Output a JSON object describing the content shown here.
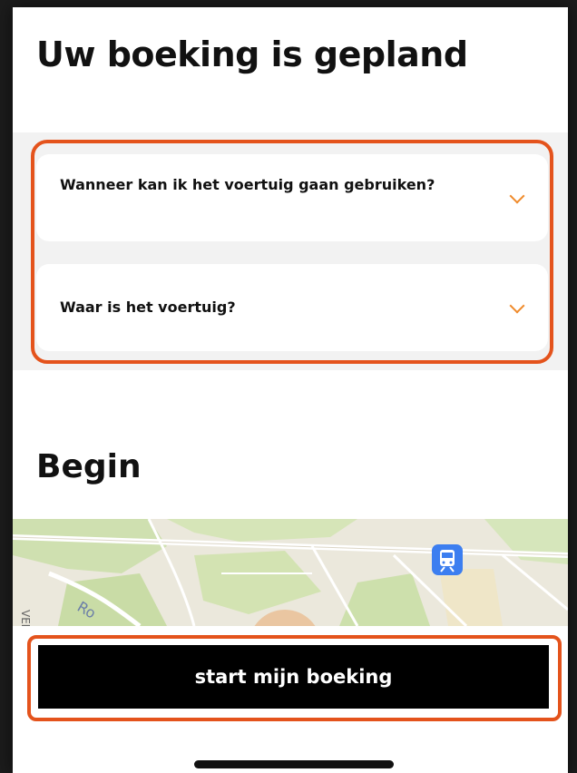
{
  "header": {
    "title": "Uw boeking is gepland"
  },
  "faq": {
    "items": [
      {
        "question": "Wanneer kan ik het voertuig gaan gebruiken?",
        "icon": "chevron-down-icon"
      },
      {
        "question": "Waar is het voertuig?",
        "icon": "chevron-down-icon"
      }
    ]
  },
  "start_section": {
    "title": "Begin"
  },
  "map": {
    "labels": {
      "street_side": "VENS",
      "street_road": "Ro"
    },
    "icons": [
      "train-station-icon"
    ]
  },
  "actions": {
    "start_label": "start mijn boeking"
  },
  "colors": {
    "accent": "#ef8a2a",
    "highlight": "#e4531c",
    "button": "#000000"
  }
}
